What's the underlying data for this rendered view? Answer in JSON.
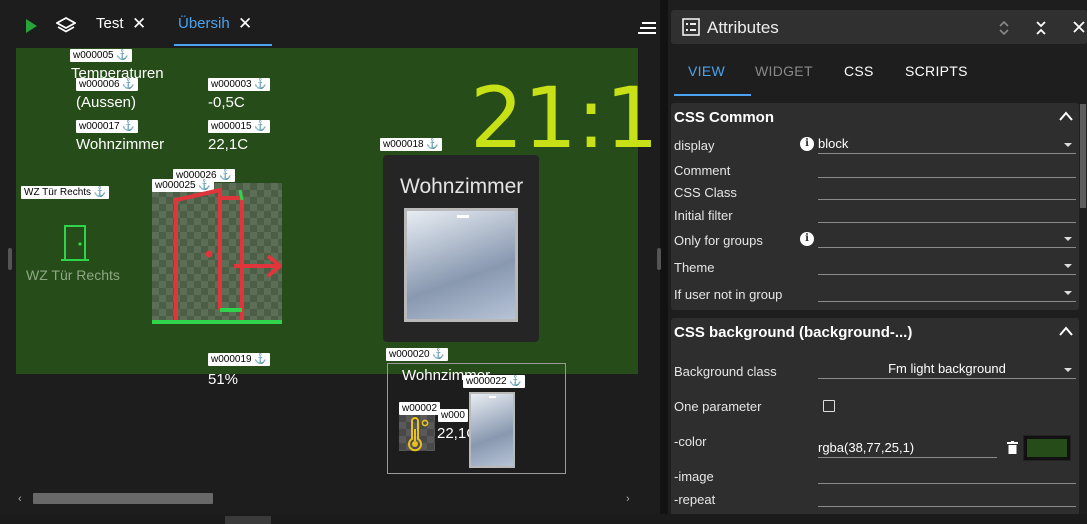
{
  "editor": {
    "tabs": [
      {
        "label": "Test",
        "active": false
      },
      {
        "label": "Übersih",
        "active": true
      }
    ]
  },
  "canvas": {
    "background": "#264d19",
    "labels": {
      "w5": "w000005 ⚓",
      "w6": "w000006 ⚓",
      "w3": "w000003 ⚓",
      "w17": "w000017 ⚓",
      "w15": "w000015 ⚓",
      "w26": "w000026 ⚓",
      "w25": "w000025 ⚓",
      "wz": "WZ Tür Rechts ⚓",
      "w18": "w000018 ⚓",
      "w19": "w000019 ⚓",
      "w20": "w000020 ⚓",
      "w22": "w000022 ⚓",
      "w23": "w00002",
      "w24": "w000"
    },
    "texts": {
      "temperaturen": "Temperaturen",
      "aussen": "(Aussen)",
      "aussen_value": "-0,5C",
      "wohnzimmer": "Wohnzimmer",
      "wohnzimmer_value": "22,1C",
      "clock": "21:1",
      "door_caption": "WZ Tür Rechts",
      "card_title": "Wohnzimmer",
      "humidity": "51%",
      "small_title": "Wohnzimmer",
      "small_value": "22,1C"
    }
  },
  "panel": {
    "title": "Attributes",
    "tabs": [
      "VIEW",
      "WIDGET",
      "CSS",
      "SCRIPTS"
    ],
    "active_tab": "VIEW",
    "css_common": {
      "title": "CSS Common",
      "rows": [
        {
          "label": "display",
          "value": "block"
        },
        {
          "label": "Comment",
          "value": ""
        },
        {
          "label": "CSS Class",
          "value": ""
        },
        {
          "label": "Initial filter",
          "value": ""
        },
        {
          "label": "Only for groups",
          "value": ""
        },
        {
          "label": "Theme",
          "value": ""
        },
        {
          "label": "If user not in group",
          "value": ""
        }
      ]
    },
    "css_background": {
      "title": "CSS background (background-...)",
      "background_class_label": "Background class",
      "background_class_value": "Fm light background",
      "one_parameter_label": "One parameter",
      "color_label": "-color",
      "color_value": "rgba(38,77,25,1)",
      "swatch": "#264d19",
      "image_label": "-image",
      "repeat_label": "-repeat"
    }
  },
  "colors": {
    "accent": "#4aa3f0",
    "clock": "#c8e016",
    "door_icon": "#2fd44a",
    "door_active": "#e0353b"
  }
}
